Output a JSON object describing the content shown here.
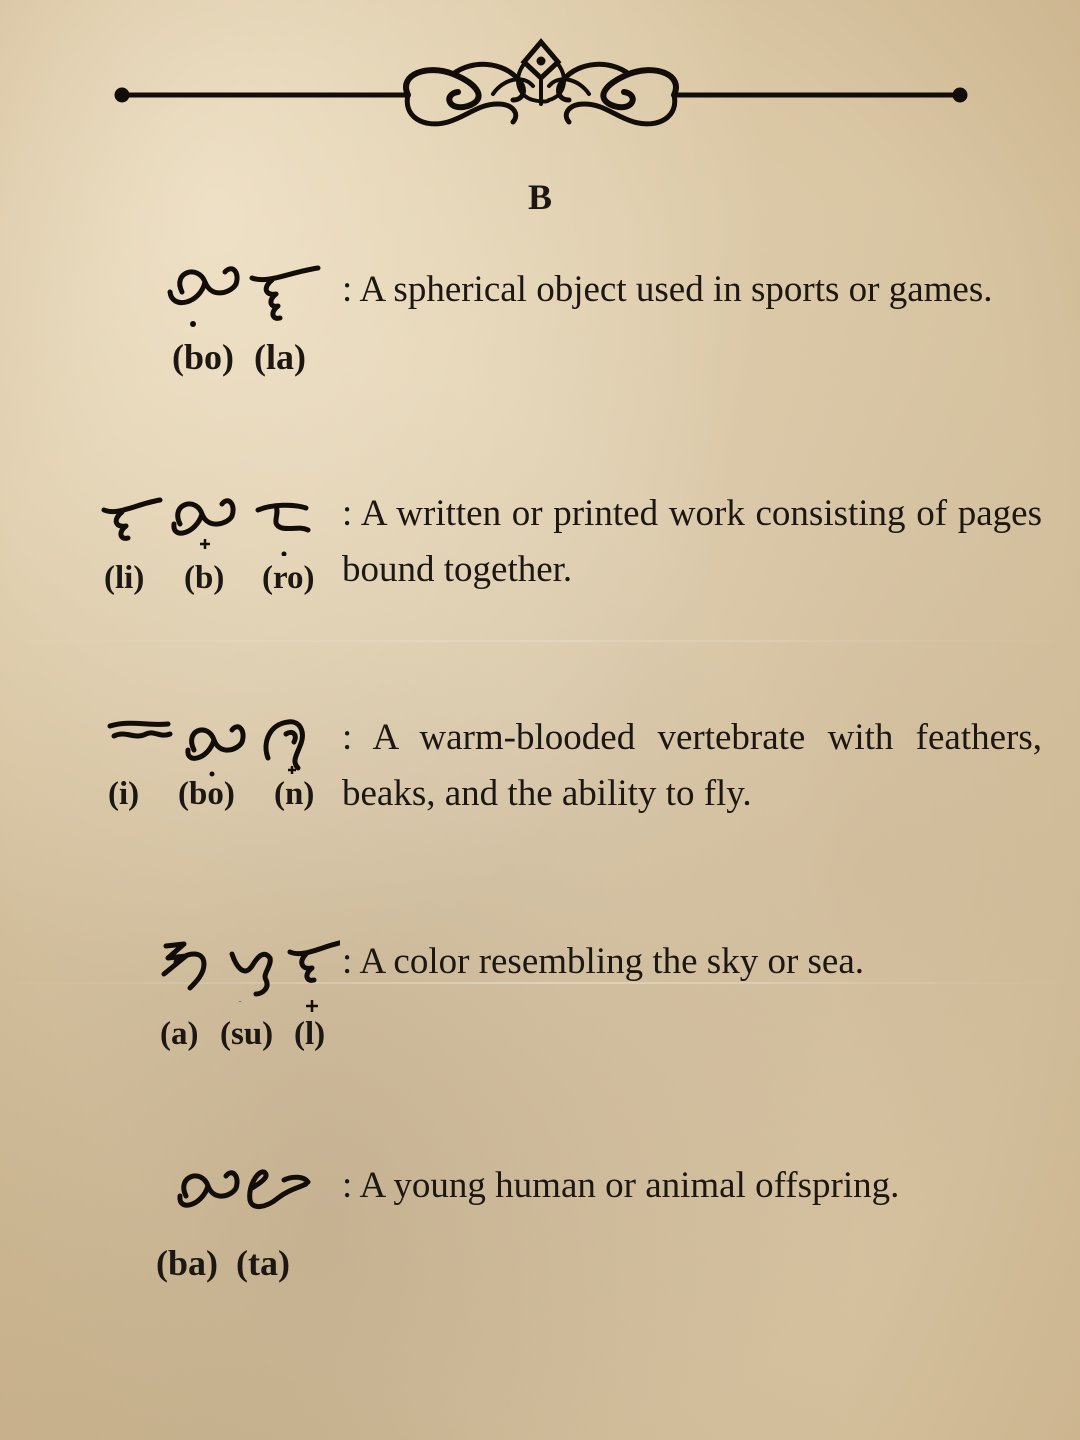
{
  "heading": {
    "letter": "B"
  },
  "entries": [
    {
      "word": "bola",
      "syllables": [
        "(bo)",
        "(la)"
      ],
      "definition": ": A spherical object used in sports or games."
    },
    {
      "word": "libro",
      "syllables": [
        "(li)",
        "(b)",
        "(ro)"
      ],
      "definition": ": A written or printed work consisting of pages bound together."
    },
    {
      "word": "ibon",
      "syllables": [
        "(i)",
        "(bo)",
        "(n)"
      ],
      "definition": ": A warm-blooded vertebrate with feathers, beaks, and the ability to fly."
    },
    {
      "word": "asul",
      "syllables": [
        "(a)",
        "(su)",
        "(l)"
      ],
      "definition": ": A color resembling the sky or sea."
    },
    {
      "word": "bata",
      "syllables": [
        "(ba)",
        "(ta)"
      ],
      "definition": ": A young human or animal offspring."
    }
  ]
}
